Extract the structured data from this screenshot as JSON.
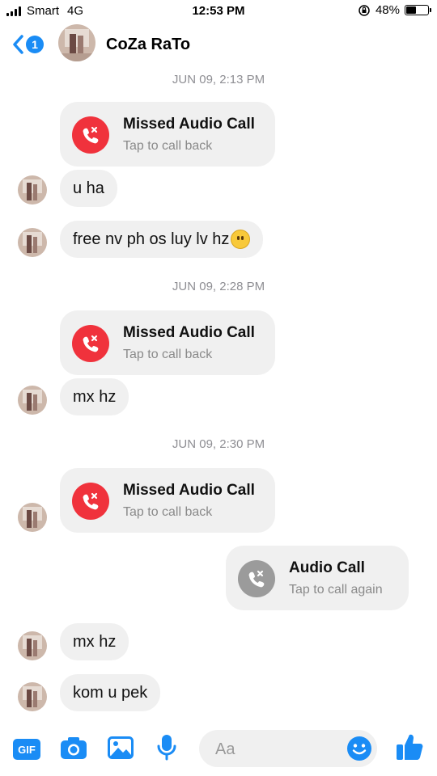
{
  "status_bar": {
    "carrier": "Smart",
    "network": "4G",
    "time": "12:53 PM",
    "battery": "48%",
    "battery_level": 0.48
  },
  "header": {
    "unread_count": "1",
    "contact_name": "CoZa RaTo"
  },
  "messages": [
    {
      "type": "timestamp",
      "text": "JUN 09, 2:13 PM"
    },
    {
      "type": "missed_call",
      "title": "Missed Audio Call",
      "subtitle": "Tap to call back"
    },
    {
      "type": "text",
      "text": "u ha"
    },
    {
      "type": "text",
      "text": "free nv ph os luy lv hz",
      "emoji": "neutral-face-emoji"
    },
    {
      "type": "timestamp",
      "text": "JUN 09, 2:28 PM"
    },
    {
      "type": "missed_call",
      "title": "Missed Audio Call",
      "subtitle": "Tap to call back"
    },
    {
      "type": "text",
      "text": "mx hz"
    },
    {
      "type": "timestamp",
      "text": "JUN 09, 2:30 PM"
    },
    {
      "type": "missed_call",
      "title": "Missed Audio Call",
      "subtitle": "Tap to call back"
    },
    {
      "type": "outgoing_call",
      "title": "Audio Call",
      "subtitle": "Tap to call again"
    },
    {
      "type": "text",
      "text": "mx hz"
    },
    {
      "type": "text",
      "text": "kom u pek"
    }
  ],
  "composer": {
    "gif_label": "GIF",
    "placeholder": "Aa"
  },
  "colors": {
    "accent": "#1a8cf5",
    "missed_call": "#f0323c",
    "call_icon_gray": "#9b9b9b",
    "bubble_bg": "#f0f0f0"
  },
  "icons": [
    "back-chevron-icon",
    "camera-icon",
    "image-icon",
    "microphone-icon",
    "smiley-icon",
    "thumbs-up-icon",
    "phone-missed-icon"
  ]
}
